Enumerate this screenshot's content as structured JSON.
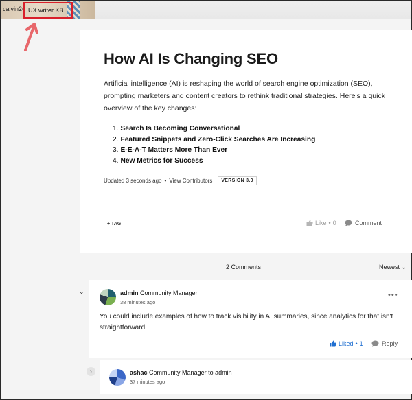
{
  "breadcrumb": {
    "user": "calvin2",
    "kb": "UX writer KB"
  },
  "article": {
    "title": "How AI Is Changing SEO",
    "intro": "Artificial intelligence (AI) is reshaping the world of search engine optimization (SEO), prompting marketers and content creators to rethink traditional strategies. Here's a quick overview of the key changes:",
    "list": [
      {
        "num": "1.",
        "text": "Search Is Becoming Conversational"
      },
      {
        "num": "2.",
        "text": "Featured Snippets and Zero-Click Searches Are Increasing"
      },
      {
        "num": "3.",
        "text": "E-E-A-T Matters More Than Ever"
      },
      {
        "num": "4.",
        "text": "New Metrics for Success"
      }
    ],
    "updated": "Updated 3 seconds ago",
    "separator": "•",
    "contributors": "View Contributors",
    "version": "VERSION 3.0",
    "tag": "+ TAG",
    "like_label": "Like",
    "like_count": "0",
    "comment_label": "Comment"
  },
  "comments_header": {
    "count": "2 Comments",
    "sort": "Newest"
  },
  "comment1": {
    "author": "admin",
    "role": "Community Manager",
    "time": "38 minutes ago",
    "body": "You could include examples of how to track visibility in AI summaries, since analytics for that isn't straightforward.",
    "liked_label": "Liked",
    "liked_count": "1",
    "reply_label": "Reply"
  },
  "comment2": {
    "author": "ashac",
    "role": "Community Manager",
    "to": "to admin",
    "time": "37 minutes ago"
  },
  "colors": {
    "highlight": "#d9202b",
    "arrow": "#e8676b",
    "liked": "#1f6fd1"
  }
}
